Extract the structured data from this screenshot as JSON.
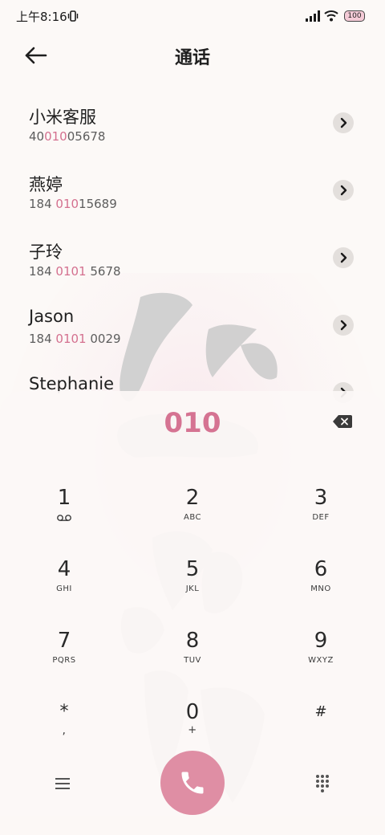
{
  "status_bar": {
    "time": "上午8:16",
    "battery": "100"
  },
  "header": {
    "title": "通话"
  },
  "contacts": [
    {
      "name": "小米客服",
      "number_pre": "40",
      "number_match": "010",
      "number_post": "05678"
    },
    {
      "name": "燕婷",
      "number_pre": "184 ",
      "number_match": "010",
      "number_post": "15689"
    },
    {
      "name": "子玲",
      "number_pre": "184 ",
      "number_match": "0101",
      "number_post": " 5678"
    },
    {
      "name": "Jason",
      "number_pre": "184 ",
      "number_match": "0101",
      "number_post": " 0029"
    },
    {
      "name": "Stephanie",
      "number_pre": "",
      "number_match": "",
      "number_post": ""
    }
  ],
  "dialer": {
    "dialed_number": "010",
    "keys": [
      {
        "digit": "1",
        "letters": ""
      },
      {
        "digit": "2",
        "letters": "ABC"
      },
      {
        "digit": "3",
        "letters": "DEF"
      },
      {
        "digit": "4",
        "letters": "GHI"
      },
      {
        "digit": "5",
        "letters": "JKL"
      },
      {
        "digit": "6",
        "letters": "MNO"
      },
      {
        "digit": "7",
        "letters": "PQRS"
      },
      {
        "digit": "8",
        "letters": "TUV"
      },
      {
        "digit": "9",
        "letters": "WXYZ"
      },
      {
        "digit": "*",
        "letters": ","
      },
      {
        "digit": "0",
        "letters": "+"
      },
      {
        "digit": "#",
        "letters": ""
      }
    ]
  },
  "icons": {
    "back": "arrow-left-icon",
    "vibrate": "vibrate-icon",
    "voicemail": "voicemail-icon",
    "backspace": "backspace-icon",
    "menu": "menu-icon",
    "call": "phone-icon",
    "keypad": "keypad-icon"
  },
  "colors": {
    "accent": "#d57392",
    "call_button": "#df8ea4",
    "background": "#fcf9f7"
  }
}
